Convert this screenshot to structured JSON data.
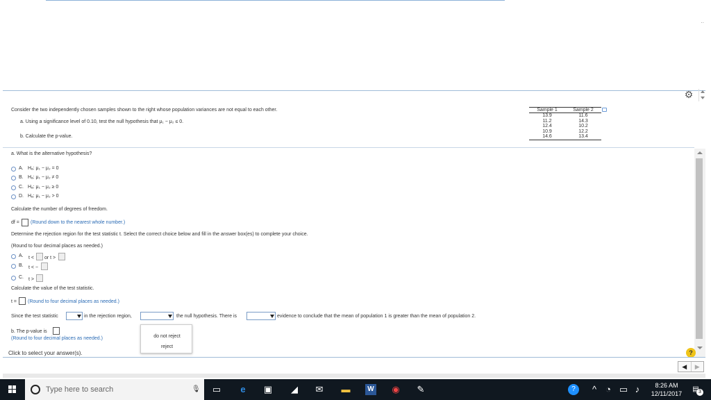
{
  "problem": {
    "intro": "Consider the two independently chosen samples shown to the right whose population variances are not equal to each other.",
    "part_a": "a. Using a significance level of 0.10, test the null hypothesis that μ₁ − μ₂ ≤ 0.",
    "part_b": "b. Calculate the p-value."
  },
  "table": {
    "headers": [
      "Sample 1",
      "Sample 2"
    ],
    "sample1": [
      "13.9",
      "11.2",
      "12.4",
      "10.9",
      "14.6"
    ],
    "sample2": [
      "11.6",
      "14.3",
      "10.2",
      "12.2",
      "13.4"
    ]
  },
  "question_a": "a. What is the alternative hypothesis?",
  "options_a": [
    {
      "letter": "A.",
      "text": "Hₐ: μ₁ − μ₂ = 0"
    },
    {
      "letter": "B.",
      "text": "Hₐ: μ₁ − μ₂ ≠ 0"
    },
    {
      "letter": "C.",
      "text": "Hₐ: μ₁ − μ₂ ≥ 0"
    },
    {
      "letter": "D.",
      "text": "Hₐ: μ₁ − μ₂ > 0"
    }
  ],
  "df_prompt": "Calculate the number of degrees of freedom.",
  "df_label": "df =",
  "df_hint": "(Round down to the nearest whole number.)",
  "rejection_prompt": "Determine the rejection region for the test statistic t. Select the correct choice below and fill in the answer box(es) to complete your choice.",
  "rejection_hint": "(Round to four decimal places as needed.)",
  "options_rej": [
    {
      "letter": "A.",
      "pre": "t <",
      "mid": "or t >"
    },
    {
      "letter": "B.",
      "pre": "t < −"
    },
    {
      "letter": "C.",
      "pre": "t >"
    }
  ],
  "stat_prompt": "Calculate the value of the test statistic.",
  "t_label": "t =",
  "t_hint": "(Round to four decimal places as needed.)",
  "since": {
    "s1": "Since the test statistic",
    "s2": "in the rejection region,",
    "s3": "the null hypothesis. There is",
    "s4": "evidence to conclude that the mean of population 1 is greater than the mean of population 2."
  },
  "popup_options": [
    "do not reject",
    "reject"
  ],
  "pvalue_label": "b. The p-value is",
  "pvalue_hint": "(Round to four decimal places as needed.)",
  "footer_text": "Click to select your answer(s).",
  "help": "?",
  "taskbar": {
    "search_placeholder": "Type here to search",
    "time": "8:26 AM",
    "date": "12/11/2017",
    "notifications": "3"
  }
}
